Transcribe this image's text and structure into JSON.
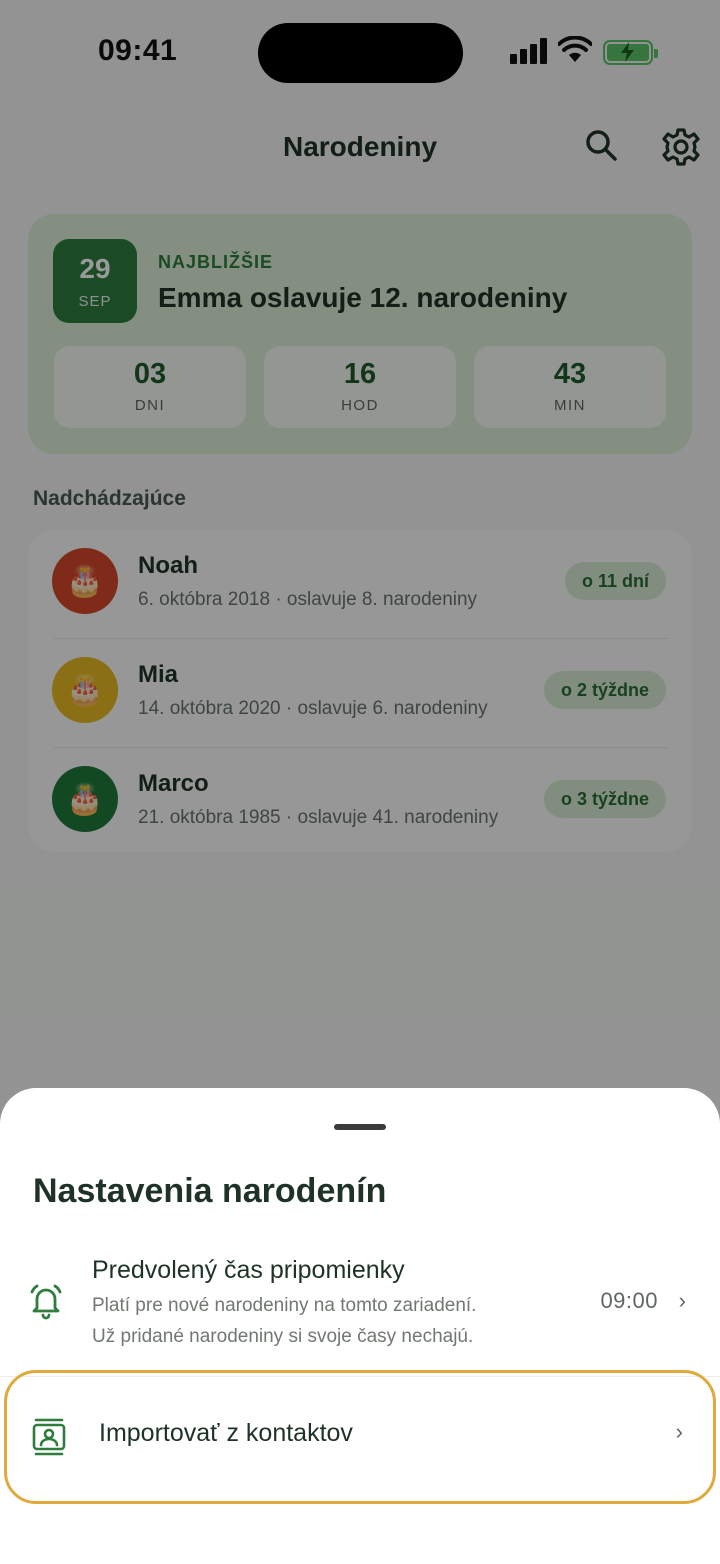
{
  "status_bar": {
    "time": "09:41"
  },
  "header": {
    "title": "Narodeniny"
  },
  "hero": {
    "day": "29",
    "month": "SEP",
    "kicker": "NAJBLIŽŠIE",
    "title": "Emma oslavuje 12. narodeniny",
    "countdown": [
      {
        "value": "03",
        "unit": "DNI"
      },
      {
        "value": "16",
        "unit": "HOD"
      },
      {
        "value": "43",
        "unit": "MIN"
      }
    ]
  },
  "upcoming": {
    "label": "Nadchádzajúce",
    "items": [
      {
        "name": "Noah",
        "detail": "6. októbra 2018 · oslavuje 8. narodeniny",
        "badge": "o 11 dní",
        "color": "#d5472a"
      },
      {
        "name": "Mia",
        "detail": "14. októbra 2020 · oslavuje 6. narodeniny",
        "badge": "o 2 týždne",
        "color": "#e8b923"
      },
      {
        "name": "Marco",
        "detail": "21. októbra 1985 · oslavuje 41. narodeniny",
        "badge": "o 3 týždne",
        "color": "#1f7a3a"
      }
    ]
  },
  "sheet": {
    "title": "Nastavenia narodenín",
    "reminder": {
      "label": "Predvolený čas pripomienky",
      "description_line1": "Platí pre nové narodeniny na tomto zariadení.",
      "description_line2": "Už pridané narodeniny si svoje časy nechajú.",
      "value": "09:00"
    },
    "import": {
      "label": "Importovať z kontaktov"
    }
  },
  "colors": {
    "accent": "#2e7d3c",
    "highlight": "#e0aa3c"
  },
  "icons": {
    "search": "search-icon",
    "settings": "gear-icon",
    "bell": "bell-icon",
    "contacts": "contacts-icon",
    "chevron": "chevron-right-icon",
    "cake": "cake-icon"
  }
}
